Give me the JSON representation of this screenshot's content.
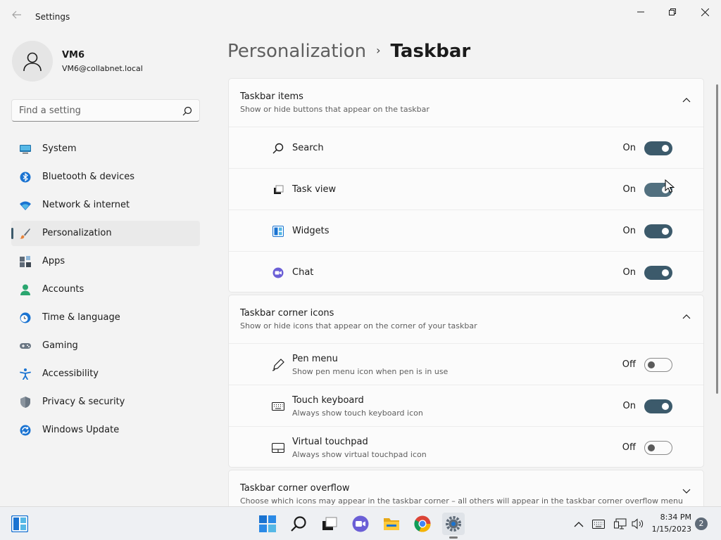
{
  "window": {
    "title": "Settings",
    "back_icon": "back-arrow-icon",
    "controls": [
      "minimize-icon",
      "maximize-icon",
      "close-icon"
    ]
  },
  "profile": {
    "name": "VM6",
    "email": "VM6@collabnet.local"
  },
  "search": {
    "placeholder": "Find a setting"
  },
  "sidebar": {
    "items": [
      {
        "label": "System",
        "icon": "system-icon",
        "selected": false
      },
      {
        "label": "Bluetooth & devices",
        "icon": "bluetooth-icon",
        "selected": false
      },
      {
        "label": "Network & internet",
        "icon": "wifi-icon",
        "selected": false
      },
      {
        "label": "Personalization",
        "icon": "paintbrush-icon",
        "selected": true
      },
      {
        "label": "Apps",
        "icon": "apps-icon",
        "selected": false
      },
      {
        "label": "Accounts",
        "icon": "accounts-icon",
        "selected": false
      },
      {
        "label": "Time & language",
        "icon": "clock-globe-icon",
        "selected": false
      },
      {
        "label": "Gaming",
        "icon": "gamepad-icon",
        "selected": false
      },
      {
        "label": "Accessibility",
        "icon": "accessibility-icon",
        "selected": false
      },
      {
        "label": "Privacy & security",
        "icon": "shield-icon",
        "selected": false
      },
      {
        "label": "Windows Update",
        "icon": "windows-update-icon",
        "selected": false
      }
    ]
  },
  "breadcrumb": {
    "parent": "Personalization",
    "separator": "›",
    "current": "Taskbar"
  },
  "sections": {
    "taskbar_items": {
      "title": "Taskbar items",
      "subtitle": "Show or hide buttons that appear on the taskbar",
      "expanded": true,
      "rows": [
        {
          "label": "Search",
          "icon": "search-icon",
          "state": "On",
          "on": true
        },
        {
          "label": "Task view",
          "icon": "task-view-icon",
          "state": "On",
          "on": true
        },
        {
          "label": "Widgets",
          "icon": "widgets-icon",
          "state": "On",
          "on": true
        },
        {
          "label": "Chat",
          "icon": "chat-icon",
          "state": "On",
          "on": true
        }
      ]
    },
    "corner_icons": {
      "title": "Taskbar corner icons",
      "subtitle": "Show or hide icons that appear on the corner of your taskbar",
      "expanded": true,
      "rows": [
        {
          "label": "Pen menu",
          "desc": "Show pen menu icon when pen is in use",
          "icon": "pen-icon",
          "state": "Off",
          "on": false
        },
        {
          "label": "Touch keyboard",
          "desc": "Always show touch keyboard icon",
          "icon": "keyboard-icon",
          "state": "On",
          "on": true
        },
        {
          "label": "Virtual touchpad",
          "desc": "Always show virtual touchpad icon",
          "icon": "touchpad-icon",
          "state": "Off",
          "on": false
        }
      ]
    },
    "corner_overflow": {
      "title": "Taskbar corner overflow",
      "subtitle": "Choose which icons may appear in the taskbar corner – all others will appear in the taskbar corner overflow menu",
      "expanded": false
    }
  },
  "taskbar": {
    "apps": [
      "start-icon",
      "search-icon",
      "task-view-icon",
      "chat-icon",
      "file-explorer-icon",
      "chrome-icon",
      "settings-icon"
    ],
    "tray": [
      "chevron-up-icon",
      "keyboard-icon",
      "network-icon",
      "volume-icon"
    ],
    "time": "8:34 PM",
    "date": "1/15/2023",
    "notification_count": "2"
  },
  "colors": {
    "accent": "#3c5a6b",
    "background": "#f3f3f3",
    "card": "#fbfbfb"
  }
}
